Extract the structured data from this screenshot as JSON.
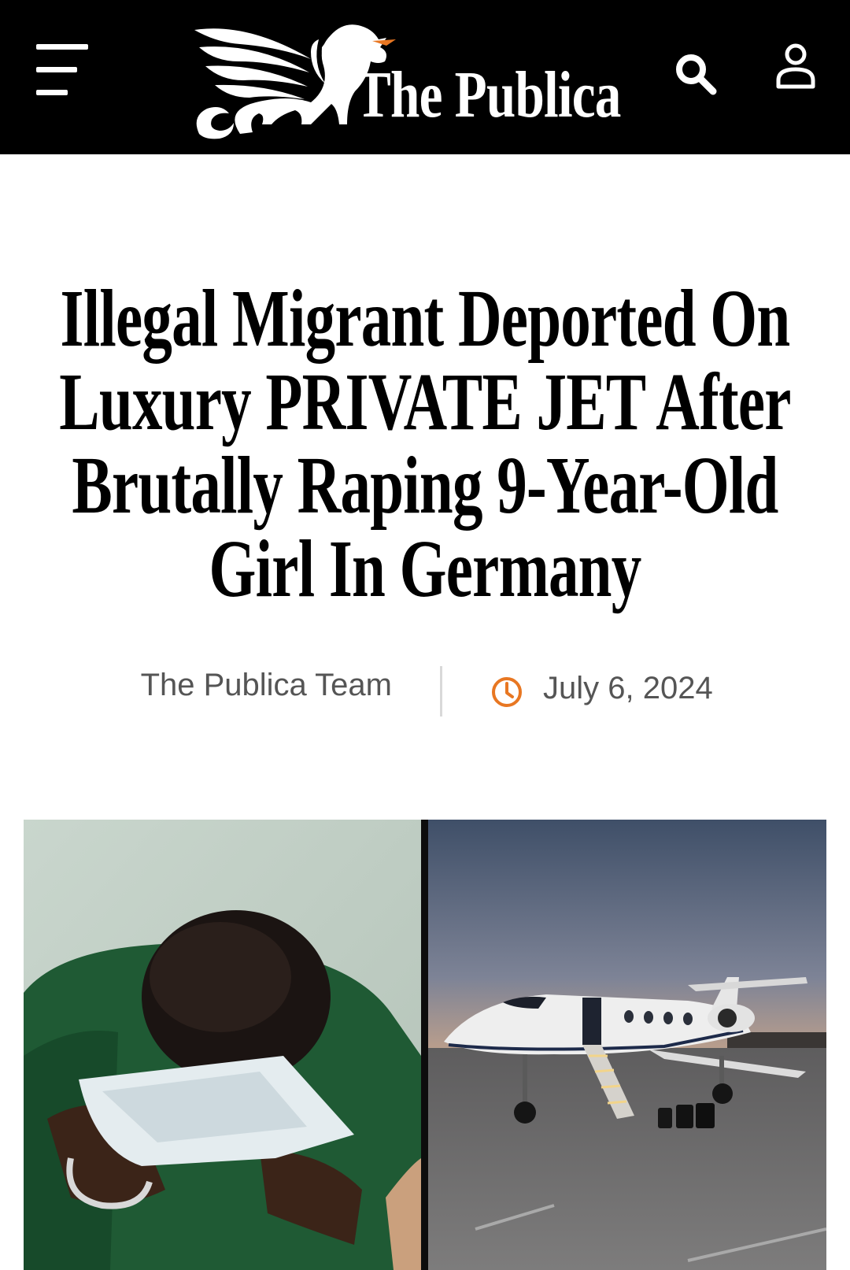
{
  "header": {
    "brand": "The Publica",
    "menu_icon": "hamburger-menu-icon",
    "search_icon": "search-icon",
    "user_icon": "user-account-icon"
  },
  "article": {
    "title": "Illegal Migrant Deported On Luxury PRIVATE JET After Brutally Raping 9-Year-Old Girl In Germany",
    "author": "The Publica Team",
    "date": "July 6, 2024",
    "date_icon": "clock-icon",
    "images": [
      {
        "subject": "man in handcuffs covering face with papers"
      },
      {
        "subject": "private jet on tarmac at sunset"
      }
    ]
  },
  "colors": {
    "header_bg": "#000000",
    "accent": "#e87722",
    "meta_text": "#555555"
  }
}
